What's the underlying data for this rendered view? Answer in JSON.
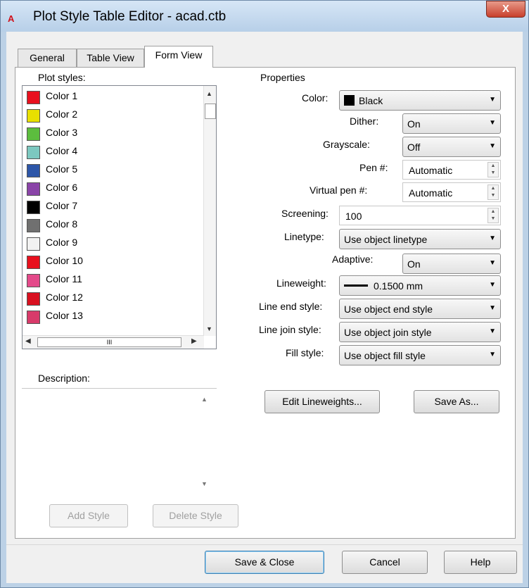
{
  "window": {
    "title": "Plot Style Table Editor - acad.ctb",
    "app_icon_text": "A",
    "close_label": "X"
  },
  "tabs": [
    {
      "label": "General"
    },
    {
      "label": "Table View"
    },
    {
      "label": "Form View"
    }
  ],
  "plot_styles": {
    "label": "Plot styles:",
    "items": [
      {
        "name": "Color 1",
        "color": "#e8101e"
      },
      {
        "name": "Color 2",
        "color": "#e8e000"
      },
      {
        "name": "Color 3",
        "color": "#5cbd3e"
      },
      {
        "name": "Color 4",
        "color": "#7cc8c0"
      },
      {
        "name": "Color 5",
        "color": "#2d56a8"
      },
      {
        "name": "Color 6",
        "color": "#8a44a8"
      },
      {
        "name": "Color 7",
        "color": "#000000"
      },
      {
        "name": "Color 8",
        "color": "#707070"
      },
      {
        "name": "Color 9",
        "color": "#f2f2f2"
      },
      {
        "name": "Color 10",
        "color": "#e8101e"
      },
      {
        "name": "Color 11",
        "color": "#e44a8a"
      },
      {
        "name": "Color 12",
        "color": "#d81020"
      },
      {
        "name": "Color 13",
        "color": "#d83a6a"
      }
    ],
    "hscroll_thumb_text": "III"
  },
  "description": {
    "label": "Description:"
  },
  "left_buttons": {
    "add_style": "Add Style",
    "delete_style": "Delete Style"
  },
  "properties": {
    "group_label": "Properties",
    "color": {
      "label": "Color:",
      "value": "Black",
      "swatch": "#000000"
    },
    "dither": {
      "label": "Dither:",
      "value": "On"
    },
    "grayscale": {
      "label": "Grayscale:",
      "value": "Off"
    },
    "pen": {
      "label": "Pen #:",
      "value": "Automatic"
    },
    "virtual_pen": {
      "label": "Virtual pen #:",
      "value": "Automatic"
    },
    "screening": {
      "label": "Screening:",
      "value": "100"
    },
    "linetype": {
      "label": "Linetype:",
      "value": "Use object linetype"
    },
    "adaptive": {
      "label": "Adaptive:",
      "value": "On"
    },
    "lineweight": {
      "label": "Lineweight:",
      "value": "0.1500 mm"
    },
    "line_end_style": {
      "label": "Line end style:",
      "value": "Use object end style"
    },
    "line_join_style": {
      "label": "Line join style:",
      "value": "Use object join style"
    },
    "fill_style": {
      "label": "Fill style:",
      "value": "Use object fill style"
    }
  },
  "property_buttons": {
    "edit_lineweights": "Edit Lineweights...",
    "save_as": "Save As..."
  },
  "footer_buttons": {
    "save_close": "Save & Close",
    "cancel": "Cancel",
    "help": "Help"
  },
  "colors": {
    "title_bar": "#c8dcf0",
    "close_button": "#c8402c",
    "dialog_bg": "#f0f0f0"
  }
}
